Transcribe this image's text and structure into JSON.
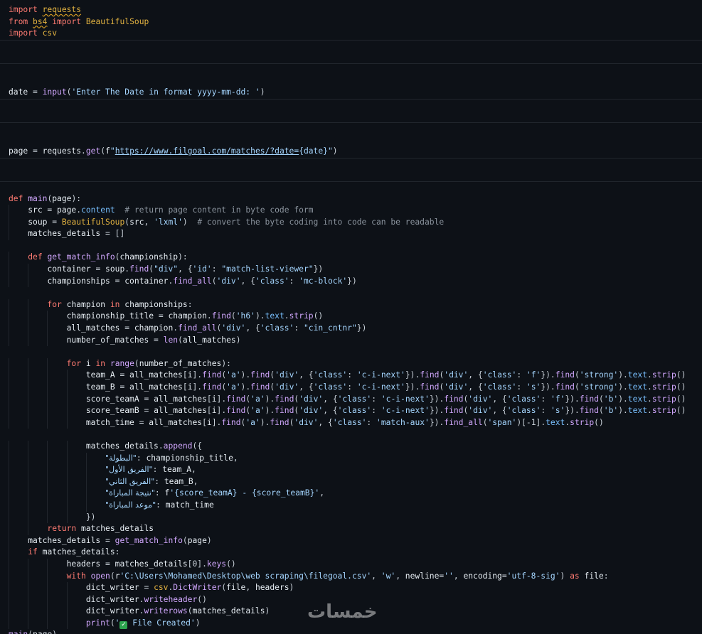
{
  "editor": {
    "lines": [
      "import requests",
      "from bs4 import BeautifulSoup",
      "import csv",
      "",
      "",
      "",
      "",
      "date = input('Enter The Date in format yyyy-mm-dd: ')",
      "",
      "",
      "",
      "",
      "page = requests.get(f\"https://www.filgoal.com/matches/?date={date}\")",
      "",
      "",
      "",
      "def main(page):",
      "    src = page.content  # return page content in byte code form",
      "    soup = BeautifulSoup(src, 'lxml')  # convert the byte coding into code can be readable",
      "    matches_details = []",
      "",
      "    def get_match_info(championship):",
      "        container = soup.find(\"div\", {'id': \"match-list-viewer\"})",
      "        championships = container.find_all('div', {'class': 'mc-block'})",
      "",
      "        for champion in championships:",
      "            championship_title = champion.find('h6').text.strip()",
      "            all_matches = champion.find_all('div', {'class': \"cin_cntnr\"})",
      "            number_of_matches = len(all_matches)",
      "",
      "            for i in range(number_of_matches):",
      "                team_A = all_matches[i].find('a').find('div', {'class': 'c-i-next'}).find('div', {'class': 'f'}).find('strong').text.strip()",
      "                team_B = all_matches[i].find('a').find('div', {'class': 'c-i-next'}).find('div', {'class': 's'}).find('strong').text.strip()",
      "                score_teamA = all_matches[i].find('a').find('div', {'class': 'c-i-next'}).find('div', {'class': 'f'}).find('b').text.strip()",
      "                score_teamB = all_matches[i].find('a').find('div', {'class': 'c-i-next'}).find('div', {'class': 's'}).find('b').text.strip()",
      "                match_time = all_matches[i].find('a').find('div', {'class': 'match-aux'}).find_all('span')[-1].text.strip()",
      "",
      "                matches_details.append({",
      "                    \"البطولة\": championship_title,",
      "                    \"الفريق الأول\": team_A,",
      "                    \"الفريق الثاني\": team_B,",
      "                    \"نتيجة المباراة\": f'{score_teamA} - {score_teamB}',",
      "                    \"موعد المباراة\": match_time",
      "                })",
      "        return matches_details",
      "    matches_details = get_match_info(page)",
      "    if matches_details:",
      "            headers = matches_details[0].keys()",
      "            with open(r'C:\\Users\\Mohamed\\Desktop\\web scraping\\filegoal.csv', 'w', newline='', encoding='utf-8-sig') as file:",
      "                dict_writer = csv.DictWriter(file, headers)",
      "                dict_writer.writeheader()",
      "                dict_writer.writerows(matches_details)",
      "                print('✅ File Created')",
      "main(page)"
    ]
  },
  "watermark": "خمسات",
  "colors": {
    "background": "#0d1117",
    "keyword": "#ff7b72",
    "string": "#a5d6ff",
    "comment": "#8b949e",
    "function": "#d2a8ff",
    "attribute": "#79c0ff"
  }
}
